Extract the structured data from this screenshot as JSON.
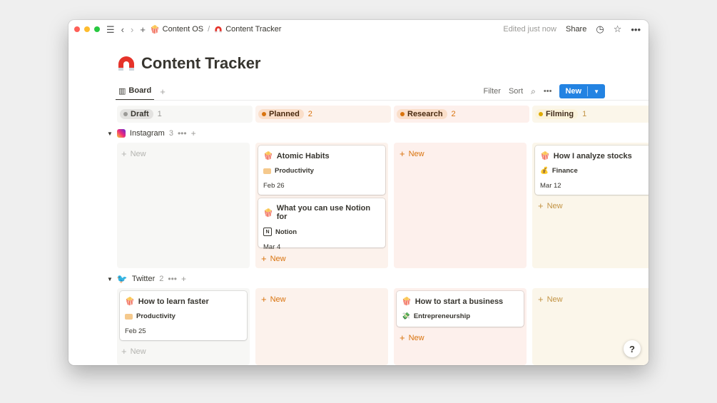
{
  "titlebar": {
    "breadcrumb_parent": "Content OS",
    "breadcrumb_sep": "/",
    "breadcrumb_current": "Content Tracker",
    "edited": "Edited just now",
    "share": "Share"
  },
  "page": {
    "title": "Content Tracker"
  },
  "viewbar": {
    "board_tab": "Board",
    "filter": "Filter",
    "sort": "Sort",
    "new_button": "New"
  },
  "columns": [
    {
      "name": "Draft",
      "count": "1",
      "dot": "#9b9a97",
      "pill_bg": "#e3e2e0",
      "head_bg": "#f7f7f5",
      "new_color": "#b4b4b0"
    },
    {
      "name": "Planned",
      "count": "2",
      "dot": "#d9730d",
      "pill_bg": "#fadec9",
      "head_bg": "#fcf2ec",
      "new_color": "#d9730d"
    },
    {
      "name": "Research",
      "count": "2",
      "dot": "#d9730d",
      "pill_bg": "#fadec9",
      "head_bg": "#fdf0ec",
      "new_color": "#d9730d"
    },
    {
      "name": "Filming",
      "count": "1",
      "dot": "#dfab01",
      "pill_bg": "#fbf3db",
      "head_bg": "#fbf6ea",
      "new_color": "#c29343"
    }
  ],
  "groups": {
    "instagram": {
      "name": "Instagram",
      "count": "3"
    },
    "twitter": {
      "name": "Twitter",
      "count": "2"
    }
  },
  "labels": {
    "new": "New"
  },
  "cards": {
    "atomic": {
      "title": "Atomic Habits",
      "tag": "Productivity",
      "date": "Feb 26"
    },
    "notion": {
      "title": "What you can use Notion for",
      "tag": "Notion",
      "date": "Mar 4"
    },
    "stocks": {
      "title": "How I analyze stocks",
      "tag": "Finance",
      "date": "Mar 12"
    },
    "learn": {
      "title": "How to learn faster",
      "tag": "Productivity",
      "date": "Feb 25"
    },
    "business": {
      "title": "How to start a business",
      "tag": "Entrepreneurship"
    }
  },
  "help": "?"
}
